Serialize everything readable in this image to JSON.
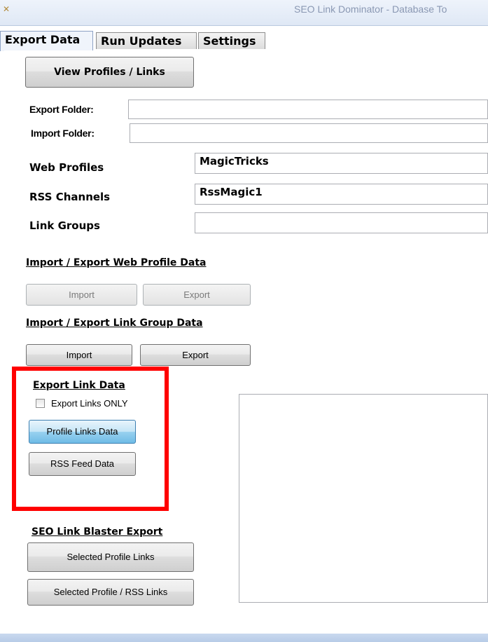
{
  "window": {
    "title": "SEO Link Dominator - Database To"
  },
  "tabs": [
    "Export Data",
    "Run Updates",
    "Settings"
  ],
  "view_profiles_button": "View Profiles / Links",
  "folders": {
    "export_label": "Export Folder:",
    "export_value": "",
    "import_label": "Import Folder:",
    "import_value": ""
  },
  "selectors": {
    "web_profiles_label": "Web Profiles",
    "web_profiles_value": "MagicTricks",
    "rss_channels_label": "RSS Channels",
    "rss_channels_value": "RssMagic1",
    "link_groups_label": "Link Groups",
    "link_groups_value": ""
  },
  "web_profile_section": {
    "heading": "Import / Export Web Profile Data",
    "import_label": "Import",
    "export_label": "Export"
  },
  "link_group_section": {
    "heading": "Import / Export Link Group Data",
    "import_label": "Import",
    "export_label": "Export"
  },
  "export_link_section": {
    "heading": "Export Link Data",
    "checkbox_label": "Export Links ONLY",
    "checkbox_checked": false,
    "profile_links_button": "Profile Links Data",
    "rss_feed_button": "RSS Feed Data"
  },
  "blaster_section": {
    "heading": "SEO Link Blaster Export",
    "selected_profile_button": "Selected Profile Links",
    "selected_profile_rss_button": "Selected Profile / RSS Links"
  },
  "colors": {
    "highlight_border": "#ff0000",
    "focused_button": "#98d1ef"
  }
}
